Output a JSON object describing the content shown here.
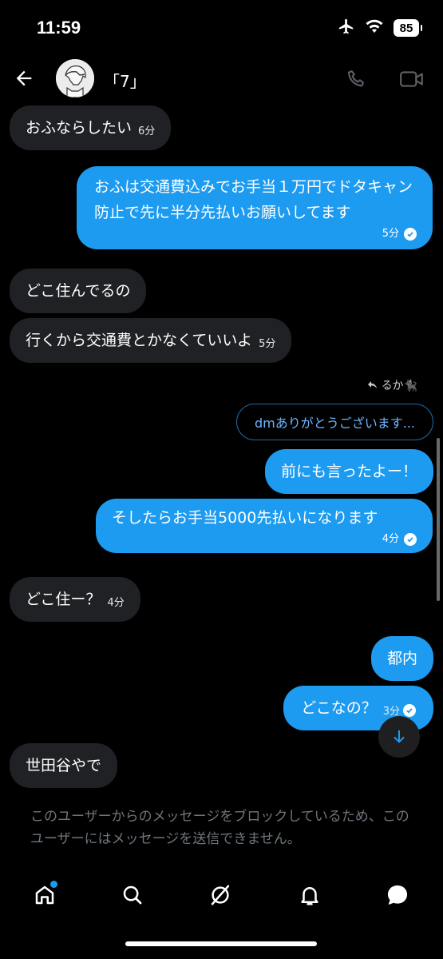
{
  "status_bar": {
    "time": "11:59",
    "battery": "85"
  },
  "header": {
    "contact_name": "「7」"
  },
  "messages": [
    {
      "text": "おふならしたい",
      "time": "6分"
    },
    {
      "text": "おふは交通費込みでお手当１万円でドタキャン防止で先に半分先払いお願いしてます",
      "time": "5分"
    },
    {
      "text": "どこ住んでるの"
    },
    {
      "text": "行くから交通費とかなくていいよ",
      "time": "5分"
    },
    {
      "text": "前にも言ったよー！"
    },
    {
      "text": "そしたらお手当5000先払いになります",
      "time": "4分"
    },
    {
      "text": "どこ住ー？",
      "time": "4分"
    },
    {
      "text": "都内"
    },
    {
      "text": "どこなの？",
      "time": "3分"
    },
    {
      "text": "世田谷やで"
    }
  ],
  "reply": {
    "label": "るか🐈‍⬛",
    "quoted_text": "dmありがとうございます..."
  },
  "blocked_notice": "このユーザーからのメッセージをブロックしているため、このユーザーにはメッセージを送信できません。",
  "colors": {
    "sent_bubble": "#1d9bf0",
    "received_bubble": "#202124",
    "background": "#000000"
  }
}
